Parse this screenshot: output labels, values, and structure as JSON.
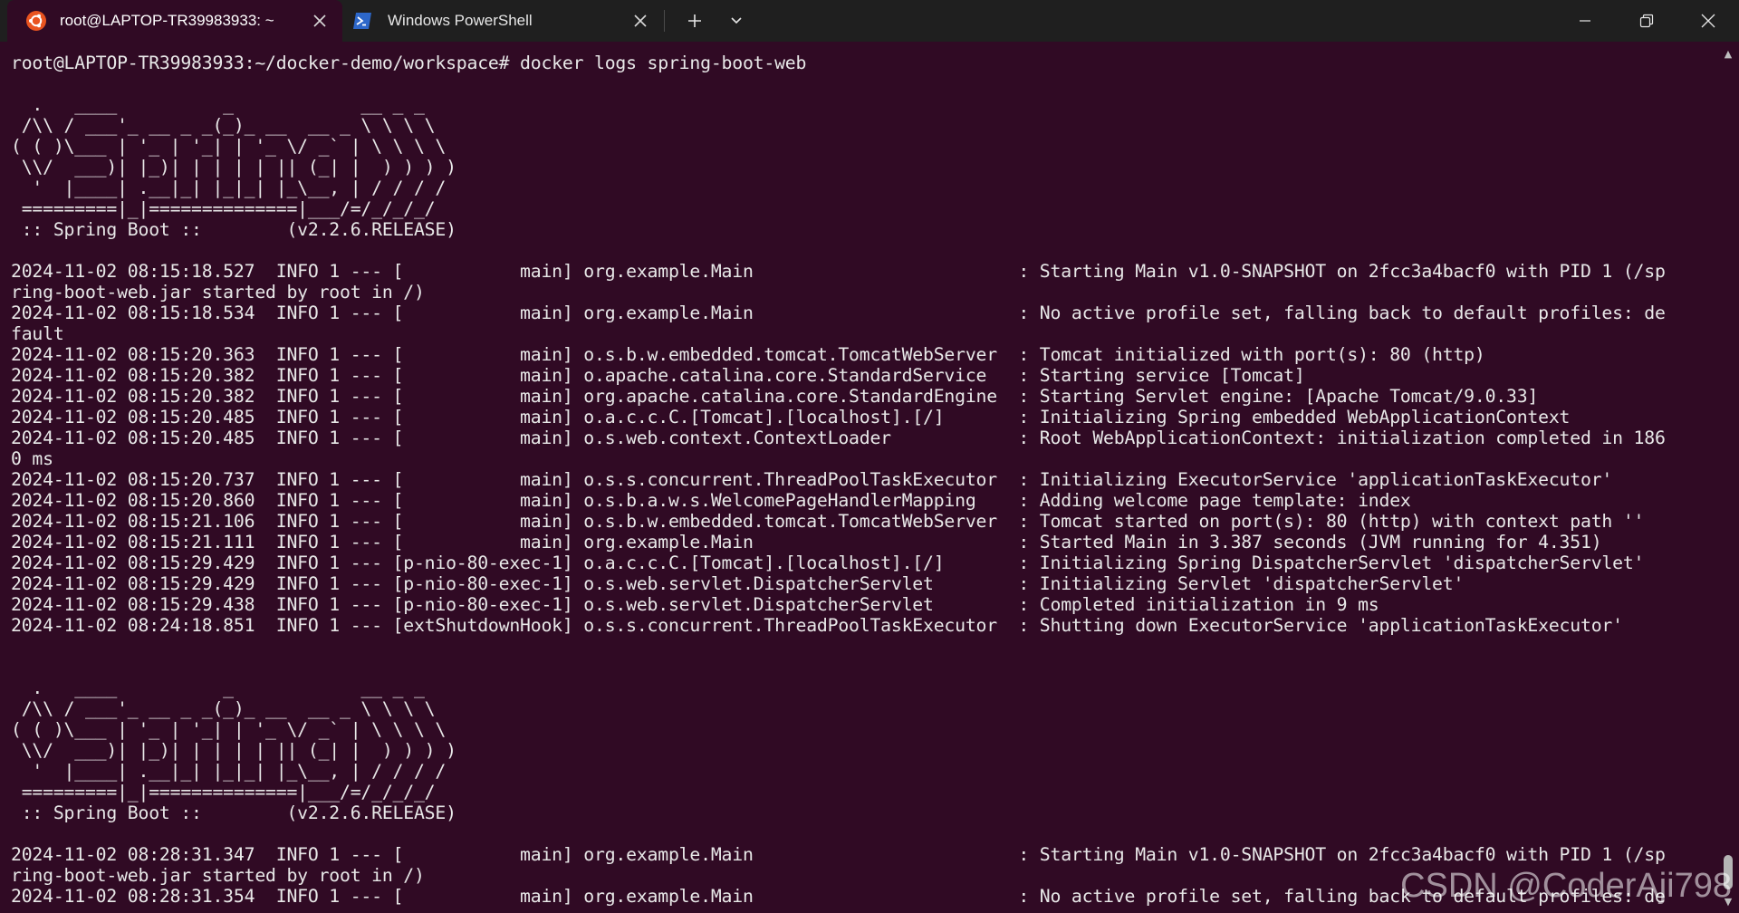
{
  "window": {
    "tabs": [
      {
        "label": "root@LAPTOP-TR39983933: ~",
        "icon": "ubuntu-icon",
        "active": true
      },
      {
        "label": "Windows PowerShell",
        "icon": "powershell-icon",
        "active": false
      }
    ],
    "new_tab_label": "+",
    "colors": {
      "background": "#300a24",
      "titlebar": "#1f1f1f",
      "text": "#e8e8e8",
      "ubuntu_orange": "#e95420",
      "powershell_blue": "#2d67c9"
    }
  },
  "terminal": {
    "lines": [
      "root@LAPTOP-TR39983933:~/docker-demo/workspace# docker logs spring-boot-web",
      "",
      "  .   ____          _            __ _ _",
      " /\\\\ / ___'_ __ _ _(_)_ __  __ _ \\ \\ \\ \\",
      "( ( )\\___ | '_ | '_| | '_ \\/ _` | \\ \\ \\ \\",
      " \\\\/  ___)| |_)| | | | | || (_| |  ) ) ) )",
      "  '  |____| .__|_| |_|_| |_\\__, | / / / /",
      " =========|_|==============|___/=/_/_/_/",
      " :: Spring Boot ::        (v2.2.6.RELEASE)",
      "",
      "2024-11-02 08:15:18.527  INFO 1 --- [           main] org.example.Main                         : Starting Main v1.0-SNAPSHOT on 2fcc3a4bacf0 with PID 1 (/sp",
      "ring-boot-web.jar started by root in /)",
      "2024-11-02 08:15:18.534  INFO 1 --- [           main] org.example.Main                         : No active profile set, falling back to default profiles: de",
      "fault",
      "2024-11-02 08:15:20.363  INFO 1 --- [           main] o.s.b.w.embedded.tomcat.TomcatWebServer  : Tomcat initialized with port(s): 80 (http)",
      "2024-11-02 08:15:20.382  INFO 1 --- [           main] o.apache.catalina.core.StandardService   : Starting service [Tomcat]",
      "2024-11-02 08:15:20.382  INFO 1 --- [           main] org.apache.catalina.core.StandardEngine  : Starting Servlet engine: [Apache Tomcat/9.0.33]",
      "2024-11-02 08:15:20.485  INFO 1 --- [           main] o.a.c.c.C.[Tomcat].[localhost].[/]       : Initializing Spring embedded WebApplicationContext",
      "2024-11-02 08:15:20.485  INFO 1 --- [           main] o.s.web.context.ContextLoader            : Root WebApplicationContext: initialization completed in 186",
      "0 ms",
      "2024-11-02 08:15:20.737  INFO 1 --- [           main] o.s.s.concurrent.ThreadPoolTaskExecutor  : Initializing ExecutorService 'applicationTaskExecutor'",
      "2024-11-02 08:15:20.860  INFO 1 --- [           main] o.s.b.a.w.s.WelcomePageHandlerMapping    : Adding welcome page template: index",
      "2024-11-02 08:15:21.106  INFO 1 --- [           main] o.s.b.w.embedded.tomcat.TomcatWebServer  : Tomcat started on port(s): 80 (http) with context path ''",
      "2024-11-02 08:15:21.111  INFO 1 --- [           main] org.example.Main                         : Started Main in 3.387 seconds (JVM running for 4.351)",
      "2024-11-02 08:15:29.429  INFO 1 --- [p-nio-80-exec-1] o.a.c.c.C.[Tomcat].[localhost].[/]       : Initializing Spring DispatcherServlet 'dispatcherServlet'",
      "2024-11-02 08:15:29.429  INFO 1 --- [p-nio-80-exec-1] o.s.web.servlet.DispatcherServlet        : Initializing Servlet 'dispatcherServlet'",
      "2024-11-02 08:15:29.438  INFO 1 --- [p-nio-80-exec-1] o.s.web.servlet.DispatcherServlet        : Completed initialization in 9 ms",
      "2024-11-02 08:24:18.851  INFO 1 --- [extShutdownHook] o.s.s.concurrent.ThreadPoolTaskExecutor  : Shutting down ExecutorService 'applicationTaskExecutor'",
      "",
      "",
      "  .   ____          _            __ _ _",
      " /\\\\ / ___'_ __ _ _(_)_ __  __ _ \\ \\ \\ \\",
      "( ( )\\___ | '_ | '_| | '_ \\/ _` | \\ \\ \\ \\",
      " \\\\/  ___)| |_)| | | | | || (_| |  ) ) ) )",
      "  '  |____| .__|_| |_|_| |_\\__, | / / / /",
      " =========|_|==============|___/=/_/_/_/",
      " :: Spring Boot ::        (v2.2.6.RELEASE)",
      "",
      "2024-11-02 08:28:31.347  INFO 1 --- [           main] org.example.Main                         : Starting Main v1.0-SNAPSHOT on 2fcc3a4bacf0 with PID 1 (/sp",
      "ring-boot-web.jar started by root in /)",
      "2024-11-02 08:28:31.354  INFO 1 --- [           main] org.example.Main                         : No active profile set, falling back to default profiles: de"
    ]
  },
  "watermark": "CSDN @CoderAji798"
}
